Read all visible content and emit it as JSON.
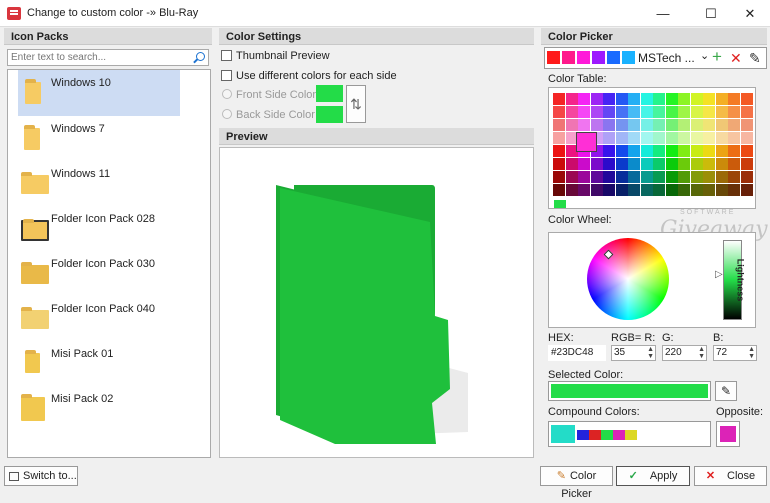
{
  "window": {
    "title": "Change to custom color -» Blu-Ray",
    "min_glyph": "—",
    "max_glyph": "☐",
    "close_glyph": "✕"
  },
  "icon_packs": {
    "header": "Icon Packs",
    "search_placeholder": "Enter text to search...",
    "items": [
      "Windows 10",
      "Windows 7",
      "Windows 11",
      "Folder Icon Pack 028",
      "Folder Icon Pack 030",
      "Folder Icon Pack 040",
      "Misi Pack 01",
      "Misi Pack 02"
    ],
    "selected_index": 0
  },
  "color_settings": {
    "header": "Color Settings",
    "thumbnail_preview": "Thumbnail Preview",
    "use_different": "Use different colors for each side",
    "front_side": "Front Side Color",
    "back_side": "Back Side Color",
    "swap_glyph": "⇅"
  },
  "preview": {
    "header": "Preview"
  },
  "color_picker": {
    "header": "Color Picker",
    "palette_name": "MSTech ...",
    "color_table_label": "Color Table:",
    "color_wheel_label": "Color Wheel:",
    "lightness_label": "Lightness",
    "hex_label": "HEX:",
    "rgb_label": "RGB= R:",
    "g_label": "G:",
    "b_label": "B:",
    "hex": "#23DC48",
    "r": "35",
    "g": "220",
    "b": "72",
    "selected_label": "Selected Color:",
    "compound_label": "Compound Colors:",
    "opposite_label": "Opposite:",
    "watermark_top": "SOFTWARE",
    "watermark": "Giveaway"
  },
  "buttons": {
    "switch_to": "Switch to...",
    "color_picker": "Color Picker",
    "apply": "Apply",
    "close": "Close"
  },
  "colors": {
    "selected": "#23DC48",
    "folder_dark": "#1aab34",
    "folder_mid": "#1fc03c",
    "opposite": "#DC23B7",
    "compound": "#23DCC8"
  }
}
